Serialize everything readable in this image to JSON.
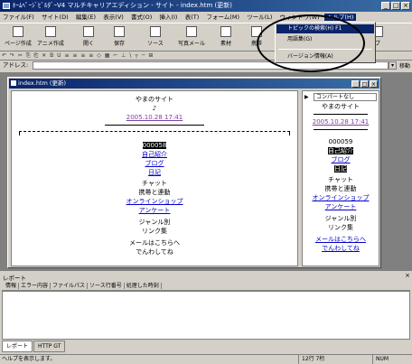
{
  "window": {
    "title": "ﾎｰﾑﾍﾟｰｼﾞﾋﾞﾙﾀﾞｰV4 マルチキャリアエディション - サイト - index.htm (更新)"
  },
  "menu": [
    "ファイル(F)",
    "サイト(D)",
    "編集(E)",
    "表示(V)",
    "書式(O)",
    "挿入(I)",
    "表(T)",
    "フォーム(M)",
    "ツール(L)",
    "ウィンドウ(W)",
    "ヘルプ(H)"
  ],
  "toolbar": [
    "ページ作成",
    "アニメ作成",
    "開く",
    "保存",
    "ソース",
    "写真メール",
    "素材",
    "携帯",
    "エ",
    "ブ"
  ],
  "toolbar2_text": "↶ ↷  ✂ ⎘ ⎗ ✕  B U   ≡ ≡ ≡ ≡   ◇ ▦ ⌐ ⊥ \\ ┬ ─ ⊞",
  "address": {
    "label": "アドレス:",
    "go": "移動"
  },
  "doc": {
    "title": "index.htm (更新)",
    "site_title": "やまのサイト",
    "date": "2005.10.28 17:41",
    "lines": [
      "自己紹介",
      "ブログ",
      "日記",
      "チャット",
      "携帯と連動",
      "オンラインショップ",
      "アンケート",
      "ジャンル別",
      "リンク集"
    ],
    "counter": "000058",
    "mail": "メールはこちらへ",
    "contact": "でんわしてね"
  },
  "preview": {
    "select": "コンパートなし",
    "title": "やまのサイト",
    "date": "2005.10.28 17:41",
    "counter": "000059",
    "lines": [
      "自己紹介",
      "ブログ",
      "日記",
      "チャット",
      "携帯と連動",
      "オンラインショップ",
      "アンケート",
      "ジャンル別",
      "リンク集"
    ],
    "mail": "メールはこちらへ",
    "contact": "でんわしてね"
  },
  "help_menu": {
    "items": [
      "トピックの検索(H) F1",
      "用語集(G)",
      "バージョン情報(A)"
    ]
  },
  "report": {
    "label": "レポート",
    "columns": [
      "情報",
      "エラー内容",
      "ファイルパス",
      "ソース行番号",
      "処理した時刻"
    ],
    "tabs": [
      "レポート",
      "HTTP GT"
    ]
  },
  "status": {
    "text": "ヘルプを表示します。",
    "pos": "12行  7桁",
    "num": "NUM"
  }
}
